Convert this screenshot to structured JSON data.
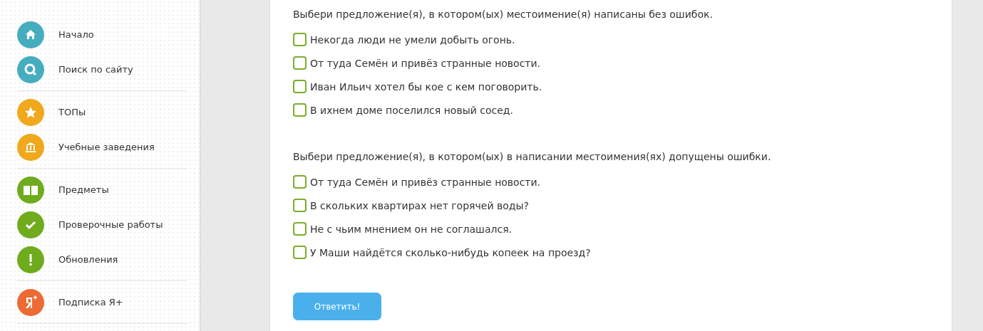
{
  "sidebar": {
    "groups": [
      {
        "items": [
          {
            "label": "Начало",
            "kind": "home",
            "color": "#46adbf"
          },
          {
            "label": "Поиск по сайту",
            "kind": "search",
            "color": "#46adbf"
          }
        ]
      },
      {
        "items": [
          {
            "label": "ТОПы",
            "kind": "star",
            "color": "#f0a81c"
          },
          {
            "label": "Учебные заведения",
            "kind": "building",
            "color": "#f0a81c"
          }
        ]
      },
      {
        "items": [
          {
            "label": "Предметы",
            "kind": "book",
            "color": "#6fab1c"
          },
          {
            "label": "Проверочные работы",
            "kind": "check",
            "color": "#6fab1c"
          },
          {
            "label": "Обновления",
            "kind": "exclaim",
            "color": "#6fab1c"
          }
        ]
      },
      {
        "items": [
          {
            "label": "Подписка Я+",
            "kind": "yaplus",
            "color": "#ec6a33"
          }
        ]
      }
    ]
  },
  "questions": [
    {
      "prompt": "Выбери предложение(я), в котором(ых) местоимение(я) написаны без ошибок.",
      "options": [
        {
          "text": "Некогда люди не умели добыть огонь.",
          "checked": false
        },
        {
          "text": "От туда Семён и привёз странные новости.",
          "checked": false
        },
        {
          "text": "Иван Ильич хотел бы кое с кем поговорить.",
          "checked": false
        },
        {
          "text": "В ихнем доме поселился новый сосед.",
          "checked": false
        }
      ]
    },
    {
      "prompt": "Выбери предложение(я), в котором(ых) в написании местоимения(ях) допущены ошибки.",
      "options": [
        {
          "text": "От туда Семён и привёз странные новости.",
          "checked": false
        },
        {
          "text": "В скольких квартирах нет горячей воды?",
          "checked": false
        },
        {
          "text": "Не с чьим мнением он не соглашался.",
          "checked": false
        },
        {
          "text": "У Маши найдётся сколько-нибудь копеек на проезд?",
          "checked": false
        }
      ]
    }
  ],
  "submit_button": "Ответить!"
}
